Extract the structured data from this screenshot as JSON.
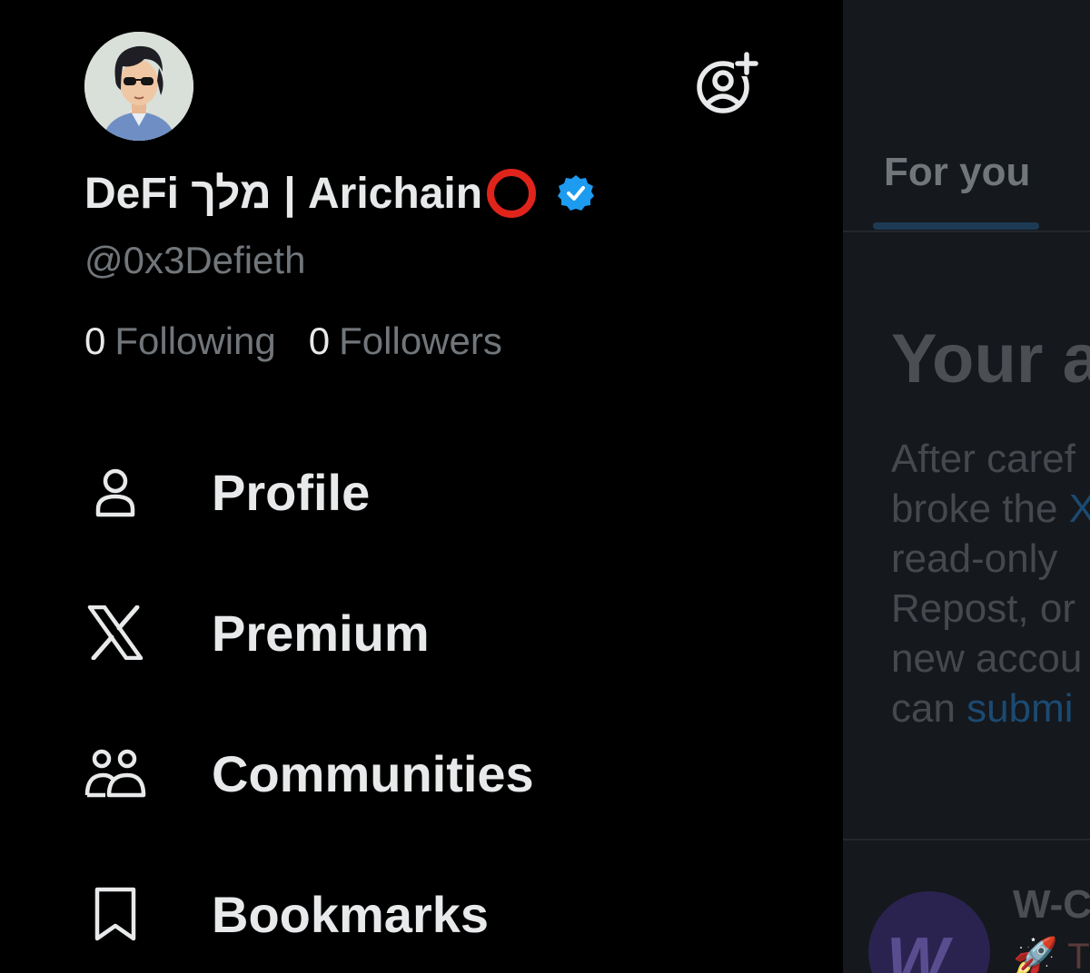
{
  "profile": {
    "display_name": "DeFi מלך | Arichain",
    "handle": "@0x3Defieth",
    "following_count": "0",
    "following_label": "Following",
    "followers_count": "0",
    "followers_label": "Followers",
    "verified_color": "#1d9bf0",
    "name_mark_color": "#e0241c"
  },
  "header": {
    "add_account_icon": "add-account-icon"
  },
  "menu": {
    "items": [
      {
        "label": "Profile",
        "icon": "person-icon"
      },
      {
        "label": "Premium",
        "icon": "x-logo-icon"
      },
      {
        "label": "Communities",
        "icon": "people-icon"
      },
      {
        "label": "Bookmarks",
        "icon": "bookmark-icon"
      }
    ]
  },
  "timeline": {
    "tab_label": "For you",
    "heading": "Your a",
    "body_lines": [
      "After caref",
      "broke the ",
      "read-only ",
      "Repost, or",
      "new accou",
      "can "
    ],
    "body_x_fragment": "X",
    "link_text": "submi",
    "post_name": "W-C",
    "post_emoji": "🚀 T"
  },
  "colors": {
    "background": "#000000",
    "text_primary": "#e7e9ea",
    "text_secondary": "#71767b",
    "accent": "#1d9bf0"
  }
}
